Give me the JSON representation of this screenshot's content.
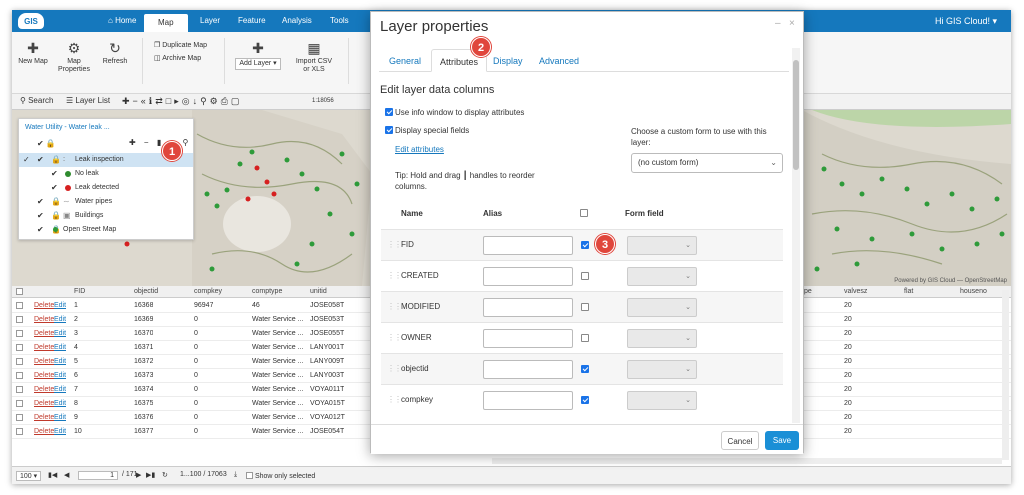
{
  "app": {
    "logo": "GIS",
    "nav": [
      "Home",
      "Map",
      "Layer",
      "Feature",
      "Analysis",
      "Tools"
    ],
    "active_nav": "Map",
    "greeting": "Hi GIS Cloud! ▾"
  },
  "ribbon": {
    "new_map": "New Map",
    "map_properties_1": "Map",
    "map_properties_2": "Properties",
    "refresh": "Refresh",
    "duplicate_map": "Duplicate Map",
    "archive_map": "Archive Map",
    "add_layer": "Add Layer ▾",
    "import_csv_1": "Import CSV",
    "import_csv_2": "or XLS"
  },
  "mapbar": {
    "search": "Search",
    "layer_list": "Layer List",
    "scale": "1:18056"
  },
  "layer_panel": {
    "title": "Water Utility - Water leak ...",
    "layers": [
      {
        "label": "Leak inspection",
        "selected": true
      },
      {
        "label": "No leak",
        "color": "#2e8b2e"
      },
      {
        "label": "Leak detected",
        "color": "#d62020"
      },
      {
        "label": "Water pipes"
      },
      {
        "label": "Buildings"
      },
      {
        "label": "Open Street Map"
      }
    ]
  },
  "map_attribution": "Powered by GIS Cloud — OpenStreetMap",
  "table": {
    "headers": [
      "FID",
      "objectid",
      "compkey",
      "comptype",
      "unitid"
    ],
    "right_headers": [
      "pe",
      "valvesz",
      "flat",
      "houseno"
    ],
    "delete_label": "Delete",
    "edit_label": "Edit",
    "rows": [
      {
        "fid": "1",
        "objectid": "16368",
        "compkey": "96947",
        "comptype": "46",
        "unitid": "JOSE058T",
        "valvesz": "20"
      },
      {
        "fid": "2",
        "objectid": "16369",
        "compkey": "0",
        "comptype": "Water Service ...",
        "unitid": "JOSE053T",
        "valvesz": "20"
      },
      {
        "fid": "3",
        "objectid": "16370",
        "compkey": "0",
        "comptype": "Water Service ...",
        "unitid": "JOSE055T",
        "valvesz": "20"
      },
      {
        "fid": "4",
        "objectid": "16371",
        "compkey": "0",
        "comptype": "Water Service ...",
        "unitid": "LANY001T",
        "valvesz": "20"
      },
      {
        "fid": "5",
        "objectid": "16372",
        "compkey": "0",
        "comptype": "Water Service ...",
        "unitid": "LANY009T",
        "valvesz": "20"
      },
      {
        "fid": "6",
        "objectid": "16373",
        "compkey": "0",
        "comptype": "Water Service ...",
        "unitid": "LANY003T",
        "valvesz": "20"
      },
      {
        "fid": "7",
        "objectid": "16374",
        "compkey": "0",
        "comptype": "Water Service ...",
        "unitid": "VOYA011T",
        "valvesz": "20"
      },
      {
        "fid": "8",
        "objectid": "16375",
        "compkey": "0",
        "comptype": "Water Service ...",
        "unitid": "VOYA015T",
        "valvesz": "20"
      },
      {
        "fid": "9",
        "objectid": "16376",
        "compkey": "0",
        "comptype": "Water Service ...",
        "unitid": "VOYA012T",
        "valvesz": "20"
      },
      {
        "fid": "10",
        "objectid": "16377",
        "compkey": "0",
        "comptype": "Water Service ...",
        "unitid": "JOSE054T",
        "valvesz": "20"
      }
    ]
  },
  "footer": {
    "page_size": "100",
    "page": "1",
    "page_total": "/ 171",
    "range": "1...100 / 17063",
    "show_only_selected": "Show only selected"
  },
  "dialog": {
    "title": "Layer properties",
    "tabs": [
      "General",
      "Attributes",
      "Display",
      "Advanced"
    ],
    "active_tab": "Attributes",
    "section_title": "Edit layer data columns",
    "use_info_window": "Use info window to display attributes",
    "display_special_fields": "Display special fields",
    "edit_attributes": "Edit attributes",
    "tip": "Tip: Hold and drag ┃ handles to reorder columns.",
    "choose_form": "Choose a custom form to use with this layer:",
    "form_select": "(no custom form)",
    "col_name": "Name",
    "col_alias": "Alias",
    "col_form": "Form field",
    "fields": [
      {
        "name": "FID",
        "checked": true
      },
      {
        "name": "CREATED",
        "checked": false
      },
      {
        "name": "MODIFIED",
        "checked": false
      },
      {
        "name": "OWNER",
        "checked": false
      },
      {
        "name": "objectid",
        "checked": true
      },
      {
        "name": "compkey",
        "checked": true
      }
    ],
    "cancel": "Cancel",
    "save": "Save"
  },
  "badges": [
    "1",
    "2",
    "3"
  ],
  "colors": {
    "brand": "#1578bd",
    "badge": "#e0463c",
    "save": "#1a8fd6"
  }
}
